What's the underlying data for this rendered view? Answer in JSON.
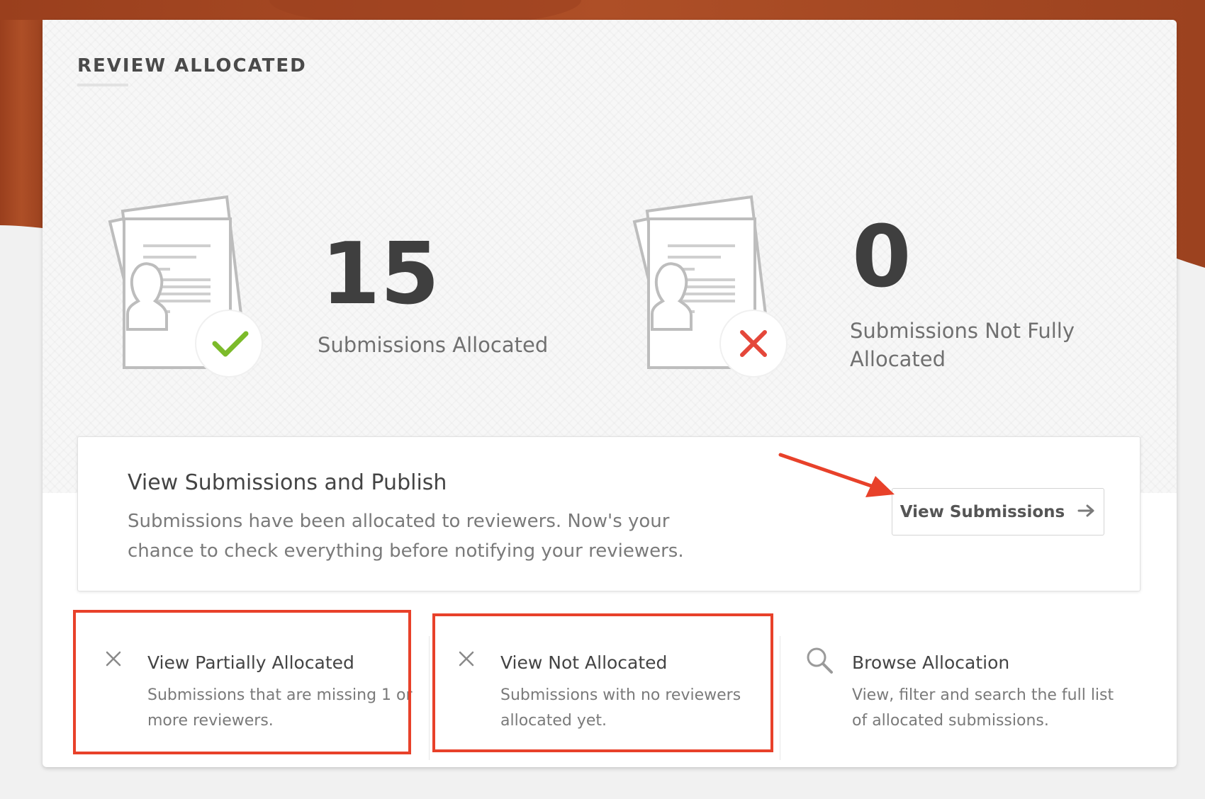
{
  "header": {
    "title": "REVIEW ALLOCATED"
  },
  "stats": {
    "allocated": {
      "number": "15",
      "label": "Submissions Allocated"
    },
    "not_allocated": {
      "number": "0",
      "label_line1": "Submissions Not Fully",
      "label_line2": "Allocated"
    }
  },
  "publish": {
    "title": "View Submissions and Publish",
    "description": "Submissions have been allocated to reviewers. Now's your chance to check everything before notifying your reviewers.",
    "button_label": "View Submissions"
  },
  "options": [
    {
      "title": "View Partially Allocated",
      "description": "Submissions that are missing 1 or more reviewers.",
      "icon": "close-icon"
    },
    {
      "title": "View Not Allocated",
      "description": "Submissions with no reviewers allocated yet.",
      "icon": "close-icon"
    },
    {
      "title": "Browse Allocation",
      "description": "View, filter and search the full list of allocated submissions.",
      "icon": "search-icon"
    }
  ],
  "colors": {
    "background_top": "#a84a24",
    "accent_green": "#7cbb2a",
    "accent_red": "#e4473a",
    "annotation_red": "#e8412a"
  }
}
